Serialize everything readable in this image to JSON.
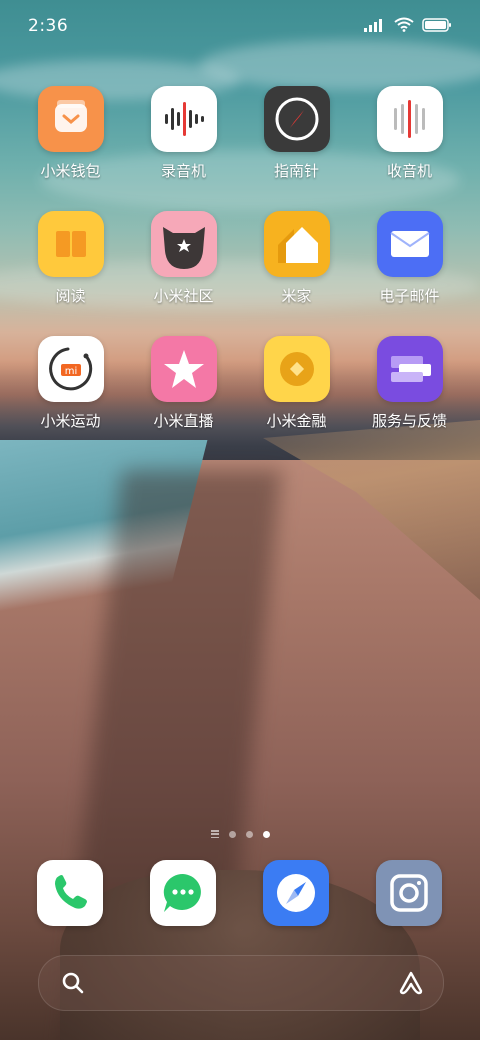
{
  "status_bar": {
    "time": "2:36"
  },
  "apps": [
    {
      "label": "小米钱包",
      "icon": "wallet-icon",
      "color": "#F7924A"
    },
    {
      "label": "录音机",
      "icon": "recorder-icon",
      "color": "#FFFFFF"
    },
    {
      "label": "指南针",
      "icon": "compass-icon",
      "color": "#3A3A3A"
    },
    {
      "label": "收音机",
      "icon": "radio-icon",
      "color": "#FFFFFF"
    },
    {
      "label": "阅读",
      "icon": "book-icon",
      "color": "#FFC93C"
    },
    {
      "label": "小米社区",
      "icon": "community-icon",
      "color": "#F6A8B8"
    },
    {
      "label": "米家",
      "icon": "home-icon",
      "color": "#F7B21F"
    },
    {
      "label": "电子邮件",
      "icon": "mail-icon",
      "color": "#4C6EF5"
    },
    {
      "label": "小米运动",
      "icon": "fitness-icon",
      "color": "#FFFFFF"
    },
    {
      "label": "小米直播",
      "icon": "star-icon",
      "color": "#F478A6"
    },
    {
      "label": "小米金融",
      "icon": "finance-icon",
      "color": "#FFD54A"
    },
    {
      "label": "服务与反馈",
      "icon": "feedback-icon",
      "color": "#7A4CE0"
    }
  ],
  "dock": [
    {
      "icon": "phone-icon",
      "color": "#FFFFFF"
    },
    {
      "icon": "messages-icon",
      "color": "#FFFFFF"
    },
    {
      "icon": "browser-icon",
      "color": "#3B7CF3"
    },
    {
      "icon": "camera-icon",
      "color": "#7F93B5"
    }
  ],
  "page_indicator": {
    "pages": 3,
    "active": 3
  }
}
